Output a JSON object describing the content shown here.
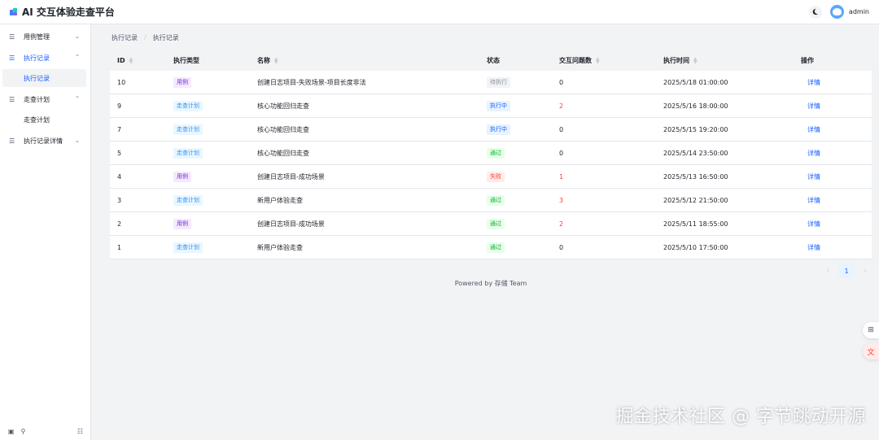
{
  "header": {
    "title": "AI 交互体验走查平台",
    "username": "admin"
  },
  "sidebar": {
    "items": [
      {
        "label": "用例管理",
        "expanded": false
      },
      {
        "label": "执行记录",
        "expanded": true,
        "children": [
          {
            "label": "执行记录",
            "selected": true
          }
        ]
      },
      {
        "label": "走查计划",
        "expanded": true,
        "children": [
          {
            "label": "走查计划",
            "selected": false
          }
        ]
      },
      {
        "label": "执行记录详情",
        "expanded": false
      }
    ]
  },
  "breadcrumb": [
    "执行记录",
    "执行记录"
  ],
  "table": {
    "columns": [
      "ID",
      "执行类型",
      "名称",
      "状态",
      "交互问题数",
      "执行时间",
      "操作"
    ],
    "rows": [
      {
        "id": "10",
        "type": "用例",
        "name": "创建日志项目-失败场景-项目长度非法",
        "status": "待执行",
        "issues": "0",
        "time": "2025/5/18 01:00:00",
        "action": "详情"
      },
      {
        "id": "9",
        "type": "走查计划",
        "name": "核心功能回归走查",
        "status": "执行中",
        "issues": "2",
        "time": "2025/5/16 18:00:00",
        "action": "详情"
      },
      {
        "id": "7",
        "type": "走查计划",
        "name": "核心功能回归走查",
        "status": "执行中",
        "issues": "0",
        "time": "2025/5/15 19:20:00",
        "action": "详情"
      },
      {
        "id": "5",
        "type": "走查计划",
        "name": "核心功能回归走查",
        "status": "通过",
        "issues": "0",
        "time": "2025/5/14 23:50:00",
        "action": "详情"
      },
      {
        "id": "4",
        "type": "用例",
        "name": "创建日志项目-成功场景",
        "status": "失败",
        "issues": "1",
        "time": "2025/5/13 16:50:00",
        "action": "详情"
      },
      {
        "id": "3",
        "type": "走查计划",
        "name": "新用户体验走查",
        "status": "通过",
        "issues": "3",
        "time": "2025/5/12 21:50:00",
        "action": "详情"
      },
      {
        "id": "2",
        "type": "用例",
        "name": "创建日志项目-成功场景",
        "status": "通过",
        "issues": "2",
        "time": "2025/5/11 18:55:00",
        "action": "详情"
      },
      {
        "id": "1",
        "type": "走查计划",
        "name": "新用户体验走查",
        "status": "通过",
        "issues": "0",
        "time": "2025/5/10 17:50:00",
        "action": "详情"
      }
    ]
  },
  "pagination": {
    "current": "1"
  },
  "footer": {
    "powered": "Powered by 存储 Team"
  },
  "watermark": "掘金技术社区 @ 字节跳动开源",
  "colors": {
    "primary": "#165dff",
    "danger": "#f53f3f",
    "success": "#00b42a",
    "purple": "#722ed1"
  }
}
